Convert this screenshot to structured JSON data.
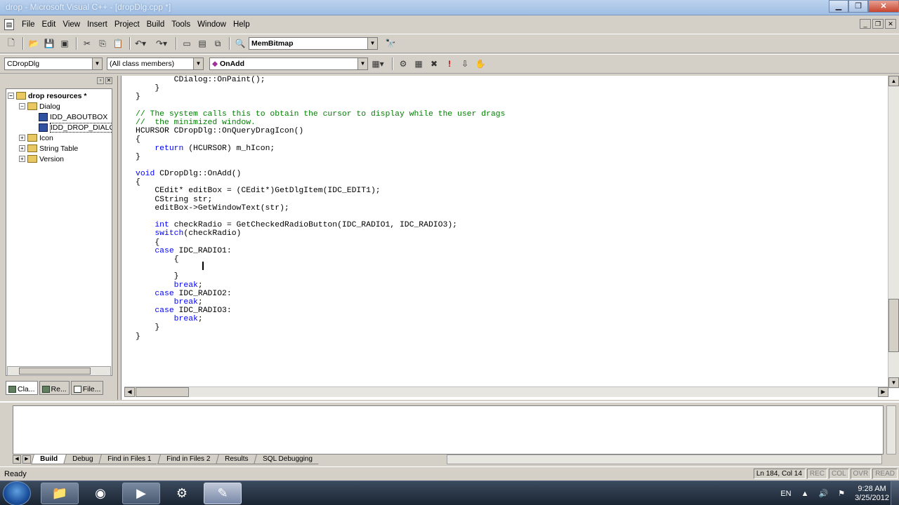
{
  "window": {
    "title": "drop - Microsoft Visual C++ - [dropDlg.cpp *]"
  },
  "menu": [
    "File",
    "Edit",
    "View",
    "Insert",
    "Project",
    "Build",
    "Tools",
    "Window",
    "Help"
  ],
  "toolbar1": {
    "find_combo": "MemBitmap"
  },
  "toolbar2": {
    "class_combo": "CDropDlg",
    "filter_combo": "(All class members)",
    "member_combo": "OnAdd"
  },
  "workspace": {
    "tree": [
      {
        "label": "drop resources *",
        "level": 0,
        "kind": "root"
      },
      {
        "label": "Dialog",
        "level": 1,
        "kind": "folder"
      },
      {
        "label": "IDD_ABOUTBOX",
        "level": 2,
        "kind": "dialog"
      },
      {
        "label": "IDD_DROP_DIALOG",
        "level": 2,
        "kind": "dialog"
      },
      {
        "label": "Icon",
        "level": 1,
        "kind": "folder"
      },
      {
        "label": "String Table",
        "level": 1,
        "kind": "folder"
      },
      {
        "label": "Version",
        "level": 1,
        "kind": "folder"
      }
    ],
    "tabs": [
      "Cla...",
      "Re...",
      "File..."
    ]
  },
  "code_lines": [
    [
      [
        "",
        "        CDialog::OnPaint();"
      ]
    ],
    [
      [
        "",
        "    }"
      ]
    ],
    [
      [
        "",
        "}"
      ]
    ],
    [
      [
        "",
        ""
      ]
    ],
    [
      [
        "cm",
        "// The system calls this to obtain the cursor to display while the user drags"
      ]
    ],
    [
      [
        "cm",
        "//  the minimized window."
      ]
    ],
    [
      [
        "",
        "HCURSOR CDropDlg::OnQueryDragIcon()"
      ]
    ],
    [
      [
        "",
        "{"
      ]
    ],
    [
      [
        "kw",
        "    return"
      ],
      [
        "",
        " (HCURSOR) m_hIcon;"
      ]
    ],
    [
      [
        "",
        "}"
      ]
    ],
    [
      [
        "",
        ""
      ]
    ],
    [
      [
        "kw",
        "void"
      ],
      [
        "",
        " CDropDlg::OnAdd()"
      ]
    ],
    [
      [
        "",
        "{"
      ]
    ],
    [
      [
        "",
        "    CEdit* editBox = (CEdit*)GetDlgItem(IDC_EDIT1);"
      ]
    ],
    [
      [
        "",
        "    CString str;"
      ]
    ],
    [
      [
        "",
        "    editBox->GetWindowText(str);"
      ]
    ],
    [
      [
        "",
        ""
      ]
    ],
    [
      [
        "kw",
        "    int"
      ],
      [
        "",
        " checkRadio = GetCheckedRadioButton(IDC_RADIO1, IDC_RADIO3);"
      ]
    ],
    [
      [
        "kw",
        "    switch"
      ],
      [
        "",
        "(checkRadio)"
      ]
    ],
    [
      [
        "",
        "    {"
      ]
    ],
    [
      [
        "kw",
        "    case"
      ],
      [
        "",
        " IDC_RADIO1:"
      ]
    ],
    [
      [
        "",
        "        {"
      ]
    ],
    [
      [
        "",
        ""
      ]
    ],
    [
      [
        "",
        "        }"
      ]
    ],
    [
      [
        "kw",
        "        break"
      ],
      [
        "",
        ";"
      ]
    ],
    [
      [
        "kw",
        "    case"
      ],
      [
        "",
        " IDC_RADIO2:"
      ]
    ],
    [
      [
        "kw",
        "        break"
      ],
      [
        "",
        ";"
      ]
    ],
    [
      [
        "kw",
        "    case"
      ],
      [
        "",
        " IDC_RADIO3:"
      ]
    ],
    [
      [
        "kw",
        "        break"
      ],
      [
        "",
        ";"
      ]
    ],
    [
      [
        "",
        "    }"
      ]
    ],
    [
      [
        "",
        "}"
      ]
    ]
  ],
  "output": {
    "tabs": [
      "Build",
      "Debug",
      "Find in Files 1",
      "Find in Files 2",
      "Results",
      "SQL Debugging"
    ]
  },
  "status": {
    "text": "Ready",
    "position": "Ln 184, Col 14",
    "rec": "REC",
    "col": "COL",
    "ovr": "OVR",
    "read": "READ"
  },
  "taskbar": {
    "lang": "EN",
    "time": "9:28 AM",
    "date": "3/25/2012"
  },
  "colors": {
    "keyword": "#0000ff",
    "comment": "#008000",
    "chrome": "#d4d0c8"
  }
}
